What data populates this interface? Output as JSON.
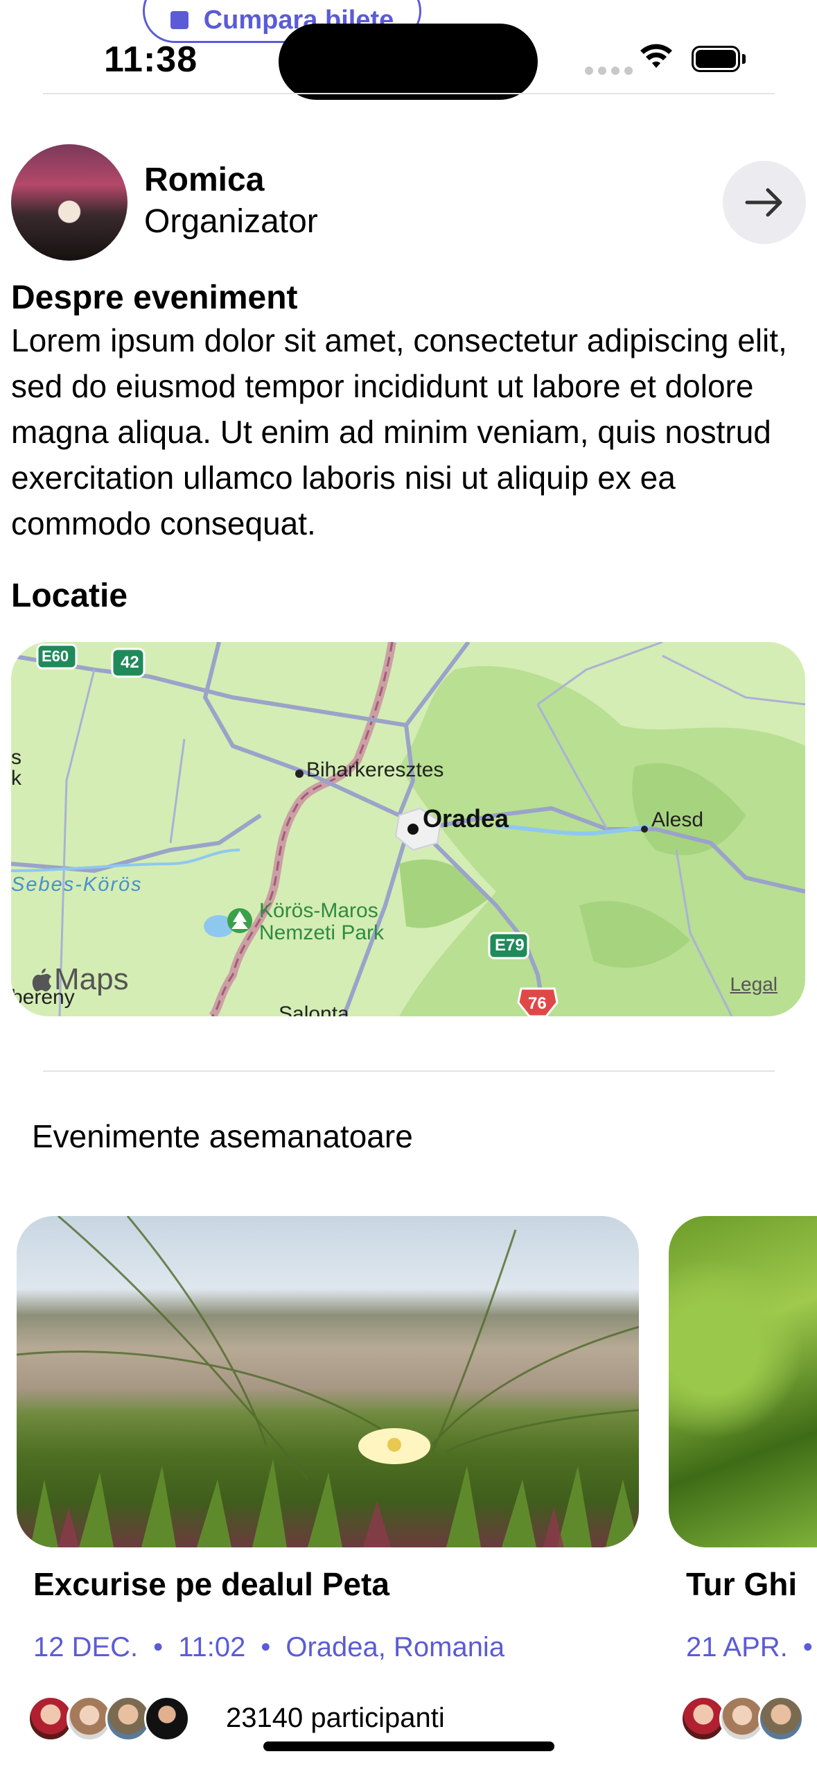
{
  "status_bar": {
    "time": "11:38"
  },
  "top_button": {
    "label": "Cumpara bilete"
  },
  "organizer": {
    "name": "Romica",
    "role": "Organizator"
  },
  "about": {
    "title": "Despre eveniment",
    "text": "Lorem ipsum dolor sit amet, consectetur adipiscing elit, sed do eiusmod tempor incididunt ut labore et dolore magna aliqua. Ut enim ad minim veniam, quis nostrud exercitation ullamco laboris nisi ut aliquip ex ea commodo consequat."
  },
  "location": {
    "title": "Locatie",
    "map": {
      "labels": {
        "e60": "E60",
        "r42": "42",
        "biharkeresztes": "Biharkeresztes",
        "oradea": "Oradea",
        "alesd": "Alesd",
        "sebes_koros": "Sebes-Körös",
        "park_line1": "Körös-Maros",
        "park_line2": "Nemzeti Park",
        "e79": "E79",
        "r76": "76",
        "salonta": "Salonta",
        "bereny": "bereny",
        "edge_s": "s",
        "edge_k": "k"
      },
      "brand": "Maps",
      "legal": "Legal"
    }
  },
  "similar": {
    "title": "Evenimente asemanatoare",
    "events": [
      {
        "title": "Excurise pe dealul Peta",
        "date": "12 DEC.",
        "time": "11:02",
        "place": "Oradea, Romania",
        "participants": "23140 participanti"
      },
      {
        "title": "Tur Ghi",
        "date": "21 APR."
      }
    ]
  }
}
